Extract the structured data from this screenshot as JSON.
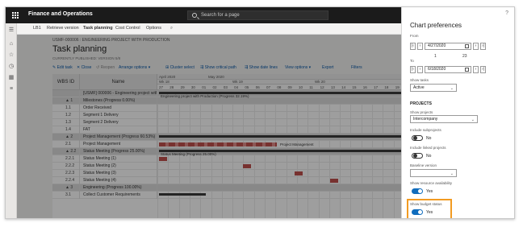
{
  "app": {
    "title": "Finance and Operations",
    "search_placeholder": "Search for a page"
  },
  "left_nav": {
    "icons": [
      "menu-icon",
      "home-icon",
      "star-icon",
      "clock-icon",
      "grid-icon",
      "list-icon"
    ],
    "glyphs": [
      "☰",
      "⌂",
      "☆",
      "◷",
      "▦",
      "≡"
    ]
  },
  "action_bar": {
    "items": [
      "LB1",
      "Retrieve version",
      "Task planning",
      "Cost Control",
      "Options"
    ],
    "active": "Task planning"
  },
  "page": {
    "breadcrumb": "USMF-000006 : ENGINEERING PROJECT WITH PRODUCTION",
    "title": "Task planning",
    "subtitle": "CURRENTLY PUBLISHED: VERSION 5/8"
  },
  "toolbar": [
    "✎ Edit task",
    "✕ Close",
    "↺ Reopen",
    "Arrange options ▾",
    "⊞ Cluster select",
    "⇶ Show critical path",
    "⇶ Show date lines",
    "View options ▾",
    "Export",
    "Filters"
  ],
  "gantt": {
    "headers": {
      "wbs": "WBS ID",
      "name": "Name"
    },
    "timeline": {
      "months": [
        "April 2020",
        "May 2020"
      ],
      "weeks": [
        "Wk 18",
        "Wk 19",
        "Wk 20"
      ],
      "days": [
        "27",
        "28",
        "29",
        "30",
        "01",
        "02",
        "03",
        "04",
        "05",
        "06",
        "07",
        "08",
        "09",
        "10",
        "11",
        "12",
        "13",
        "14",
        "15",
        "16",
        "17",
        "18",
        "19"
      ]
    },
    "rows": [
      {
        "wbs": "",
        "name": "[USMF] 000006 - Engineering project with Pro...",
        "summary": true
      },
      {
        "wbs": "▲ 1",
        "name": "Milestones (Progress 0.00%)",
        "summary": true
      },
      {
        "wbs": "1.1",
        "name": "Order Received",
        "summary": false
      },
      {
        "wbs": "1.2",
        "name": "Segment 1 Delivery",
        "summary": false
      },
      {
        "wbs": "1.3",
        "name": "Segment 2 Delivery",
        "summary": false
      },
      {
        "wbs": "1.4",
        "name": "FAT",
        "summary": false
      },
      {
        "wbs": "▲ 2",
        "name": "Project Management (Progress 60.53%)",
        "summary": true
      },
      {
        "wbs": "2.1",
        "name": "Project Management",
        "summary": false
      },
      {
        "wbs": "▲ 2.2",
        "name": "Status Meeting (Progress 25.00%)",
        "summary": true
      },
      {
        "wbs": "2.2.1",
        "name": "Status Meeting (1)",
        "summary": false
      },
      {
        "wbs": "2.2.2",
        "name": "Status Meeting (2)",
        "summary": false
      },
      {
        "wbs": "2.2.3",
        "name": "Status Meeting (3)",
        "summary": false
      },
      {
        "wbs": "2.2.4",
        "name": "Status Meeting (4)",
        "summary": false
      },
      {
        "wbs": "▲ 3",
        "name": "Engineering (Progress 100.00%)",
        "summary": true
      },
      {
        "wbs": "3.1",
        "name": "Collect Customer Requirements",
        "summary": false
      }
    ],
    "bar_labels": {
      "project": "Engineering project with Production (Progress 32.19%)",
      "pm": "Project Management",
      "status": "Status Meeting (Progress 25.00%)"
    }
  },
  "panel": {
    "title": "Chart preferences",
    "help": "?",
    "from_label": "From",
    "from_date": "4/27/2020",
    "stepper_left": "1",
    "stepper_right": "23",
    "to_label": "To",
    "to_date": "6/18/2020",
    "show_tasks_label": "Show tasks",
    "show_tasks_value": "Active",
    "projects_header": "PROJECTS",
    "show_projects_label": "Show projects",
    "show_projects_value": "Intercompany",
    "include_subprojects_label": "Include subprojects",
    "include_subprojects_value": "No",
    "include_linked_label": "Include linked projects",
    "include_linked_value": "No",
    "baseline_label": "Baseline version",
    "baseline_value": "",
    "show_resource_label": "Show resource availability",
    "show_resource_value": "Yes",
    "show_budget_label": "Show budget status",
    "show_budget_value": "Yes"
  },
  "colors": {
    "accent": "#0f6cbd",
    "highlight": "#f29b22",
    "bar_red": "#c0504d",
    "bar_summary": "#3b3b3b"
  }
}
